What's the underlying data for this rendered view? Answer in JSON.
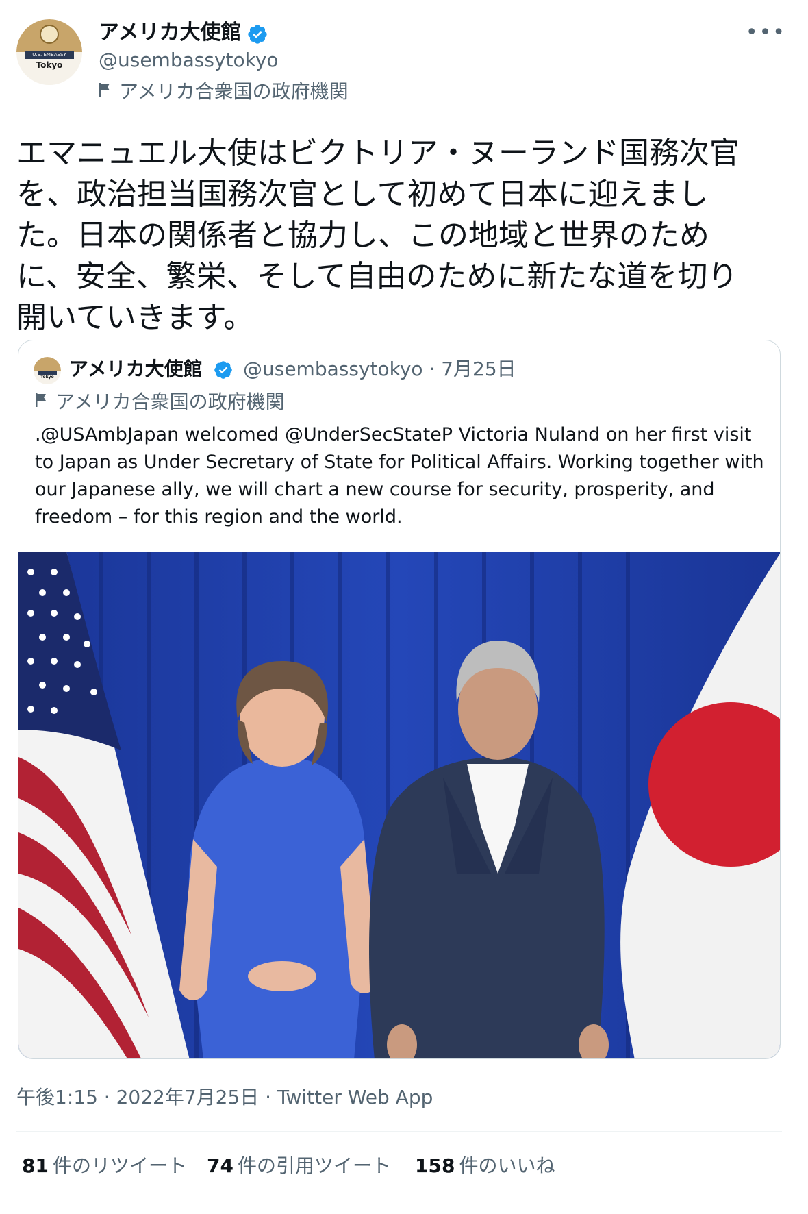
{
  "author": {
    "display_name": "アメリカ大使館",
    "handle": "@usembassytokyo",
    "gov_label": "アメリカ合衆国の政府機関",
    "avatar_band": "U.S. EMBASSY",
    "avatar_city": "Tokyo"
  },
  "more_icon": "more-horizontal-icon",
  "tweet_text": "エマニュエル大使はビクトリア・ヌーランド国務次官\nを、政治担当国務次官として初めて日本に迎えまし\nた。日本の関係者と協力し、この地域と世界のため\nに、安全、繁栄、そして自由のために新たな道を切り\n開いていきます。",
  "quoted": {
    "display_name": "アメリカ大使館",
    "handle_date": "@usembassytokyo · 7月25日",
    "gov_label": "アメリカ合衆国の政府機関",
    "text": ".@USAmbJapan welcomed @UnderSecStateP Victoria Nuland on her first visit to Japan as Under Secretary of State for Political Affairs. Working together with our Japanese ally, we will chart a new course for security, prosperity, and freedom – for this region and the world."
  },
  "timestamp": "午後1:15 · 2022年7月25日 · Twitter Web App",
  "stats": {
    "retweets_num": "81",
    "retweets_label": "件のリツイート",
    "quotes_num": "74",
    "quotes_label": "件の引用ツイート",
    "likes_num": "158",
    "likes_label": "件のいいね"
  },
  "colors": {
    "verified": "#1d9bf0",
    "secondary_text": "#536471",
    "curtain": "#1f3fa8"
  }
}
